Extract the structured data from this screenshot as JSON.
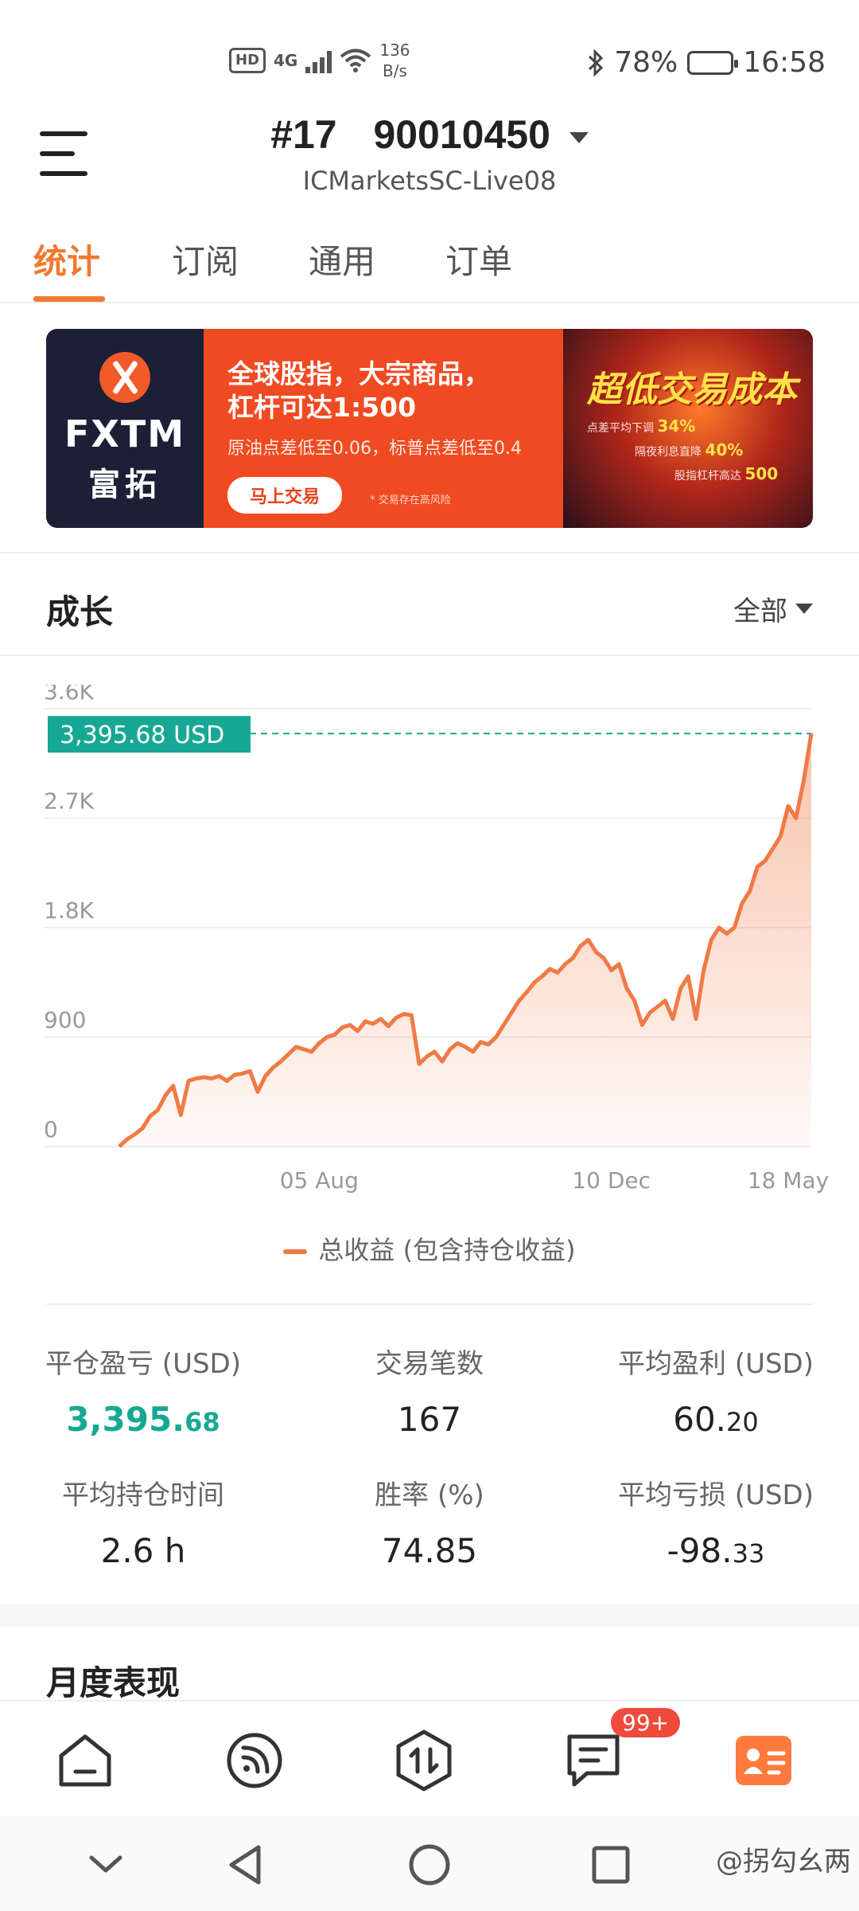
{
  "status_bar": {
    "hd": "HD",
    "network": "4G",
    "speed_value": "136",
    "speed_unit": "B/s",
    "bluetooth_icon": "bluetooth-icon",
    "battery": "78%",
    "battery_level": 0.78,
    "time": "16:58"
  },
  "header": {
    "account_rank": "#17",
    "account_number": "90010450",
    "server": "ICMarketsSC-Live08"
  },
  "tabs": [
    {
      "label": "统计",
      "active": true
    },
    {
      "label": "订阅",
      "active": false
    },
    {
      "label": "通用",
      "active": false
    },
    {
      "label": "订单",
      "active": false
    }
  ],
  "banner": {
    "brand": "FXTM",
    "brand_cn": "富拓",
    "line1": "全球股指，大宗商品，",
    "line2": "杠杆可达1:500",
    "sub": "原油点差低至0.06，标普点差低至0.4",
    "cta": "马上交易",
    "risk": "* 交易存在高风险",
    "slogan": "超低交易成本",
    "point1_text": "点差平均下调",
    "point1_value": "34%",
    "point2_text": "隔夜利息直降",
    "point2_value": "40%",
    "point3_text": "股指杠杆高达",
    "point3_value": "500"
  },
  "growth": {
    "title": "成长",
    "range": "全部",
    "current_label": "3,395.68 USD",
    "legend": "总收益 (包含持仓收益)"
  },
  "chart_data": {
    "type": "area",
    "ylim": [
      0,
      3600
    ],
    "yticks": [
      "0",
      "900",
      "1.8K",
      "2.7K",
      "3.6K"
    ],
    "ytick_values": [
      0,
      900,
      1800,
      2700,
      3600
    ],
    "xticks": [
      "05 Aug",
      "10 Dec",
      "18 May"
    ],
    "grid": true,
    "series": [
      {
        "name": "总收益 (包含持仓收益)",
        "color": "#f07a45",
        "values": [
          0,
          60,
          100,
          150,
          250,
          300,
          420,
          500,
          260,
          540,
          560,
          570,
          560,
          580,
          540,
          590,
          600,
          620,
          450,
          580,
          650,
          700,
          760,
          820,
          800,
          780,
          850,
          900,
          920,
          980,
          1000,
          950,
          1030,
          1010,
          1050,
          990,
          1060,
          1090,
          1080,
          680,
          740,
          780,
          700,
          800,
          850,
          820,
          780,
          860,
          840,
          900,
          1000,
          1100,
          1200,
          1270,
          1350,
          1400,
          1460,
          1430,
          1500,
          1550,
          1650,
          1700,
          1600,
          1550,
          1450,
          1500,
          1300,
          1200,
          1000,
          1100,
          1150,
          1200,
          1050,
          1300,
          1400,
          1050,
          1450,
          1700,
          1800,
          1750,
          1800,
          2000,
          2100,
          2300,
          2350,
          2450,
          2550,
          2800,
          2700,
          3000,
          3395.68
        ],
        "x_range": [
          "start",
          "05 Aug",
          "10 Dec",
          "18 May"
        ],
        "x_tick_index": [
          26,
          64,
          87
        ]
      }
    ],
    "current_value": 3395.68
  },
  "stats": [
    {
      "label": "平仓盈亏 (USD)",
      "int": "3,395.",
      "dec": "68",
      "green": true
    },
    {
      "label": "交易笔数",
      "int": "167",
      "dec": "",
      "green": false
    },
    {
      "label": "平均盈利 (USD)",
      "int": "60.",
      "dec": "20",
      "green": false
    },
    {
      "label": "平均持仓时间",
      "int": "2.6 h",
      "dec": "",
      "green": false
    },
    {
      "label": "胜率 (%)",
      "int": "74.85",
      "dec": "",
      "green": false
    },
    {
      "label": "平均亏损 (USD)",
      "int": "-98.",
      "dec": "33",
      "green": false
    }
  ],
  "monthly": {
    "title": "月度表现"
  },
  "bottom_nav": {
    "items": [
      "home-icon",
      "feed-icon",
      "trade-icon",
      "messages-icon",
      "profile-icon"
    ],
    "badge": "99+",
    "accent": "#ff7a3d"
  },
  "watermark": "@拐勾幺两"
}
